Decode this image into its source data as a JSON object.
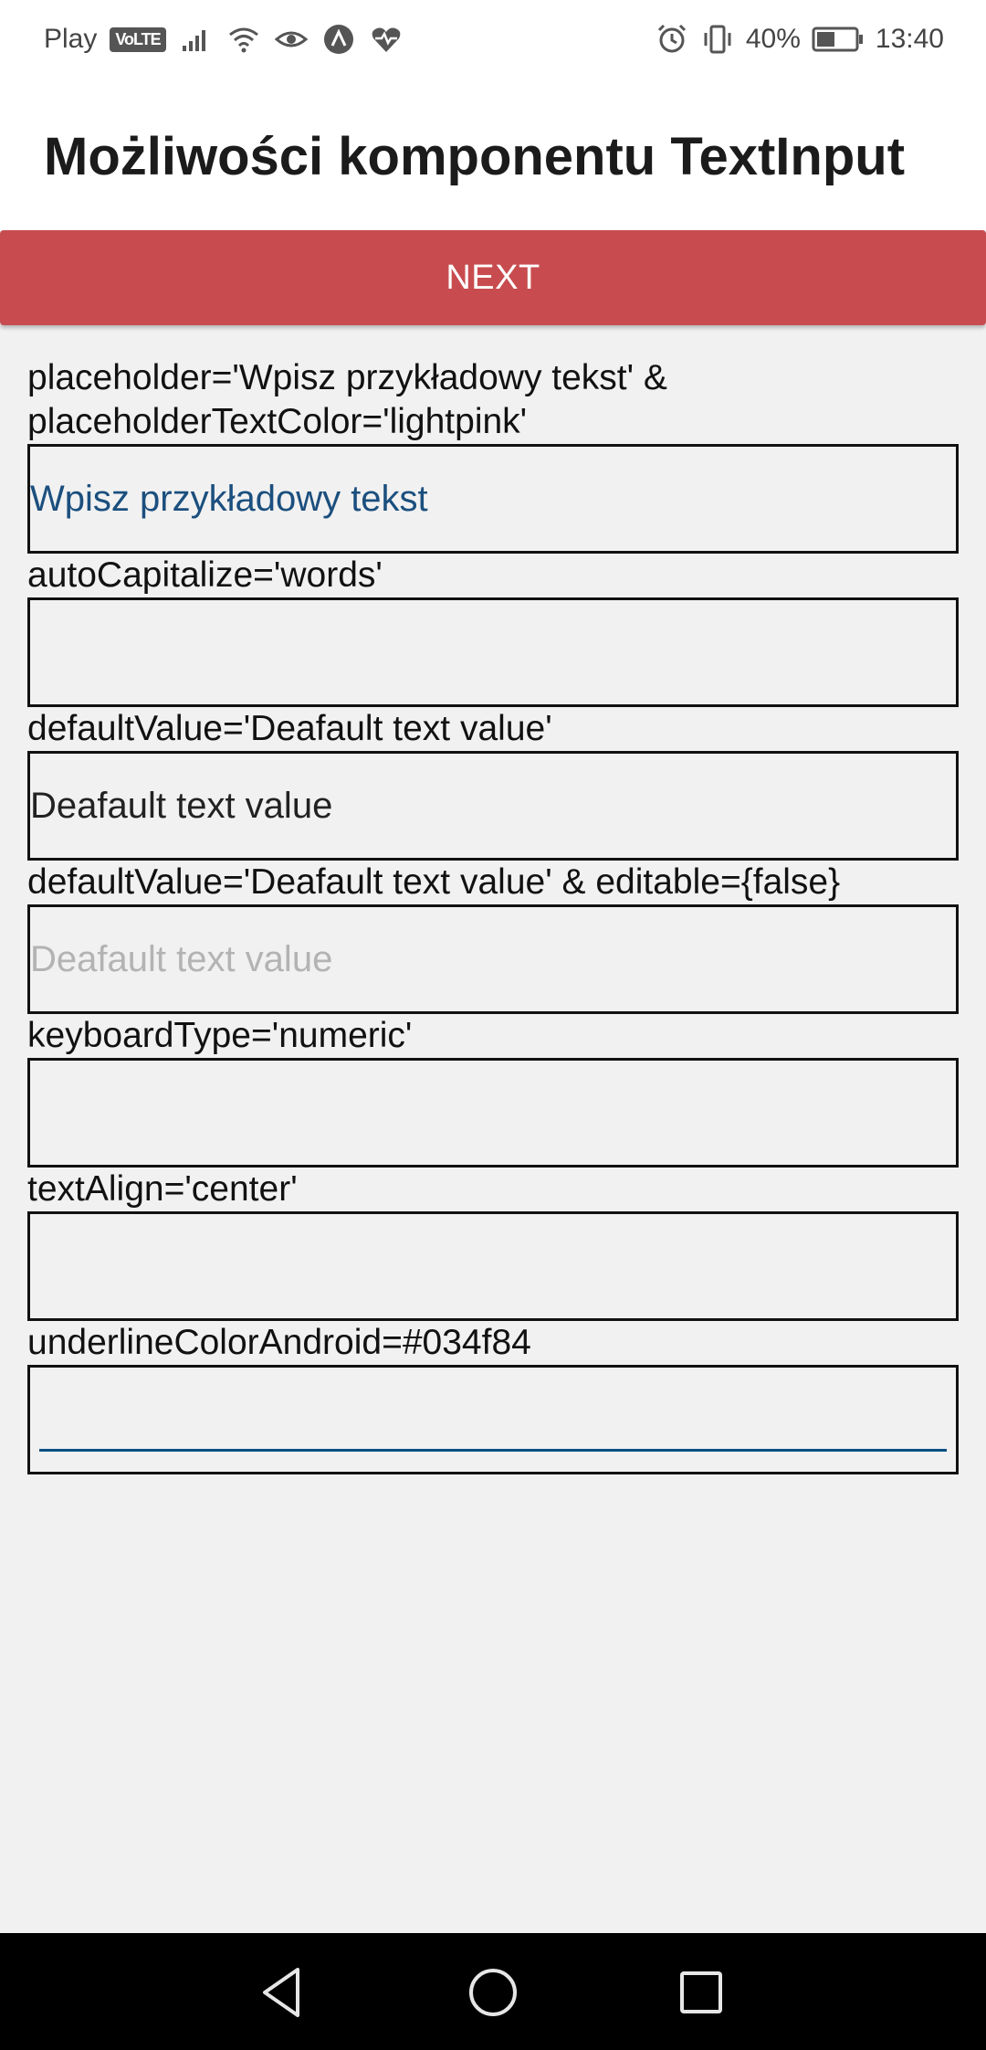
{
  "status_bar": {
    "carrier": "Play",
    "volte": "VoLTE",
    "battery": "40%",
    "time": "13:40"
  },
  "header": {
    "title": "Możliwości komponentu TextInput"
  },
  "toolbar": {
    "next_label": "NEXT"
  },
  "fields": [
    {
      "label": "placeholder='Wpisz przykładowy tekst' &\nplaceholderTextColor='lightpink'",
      "value": "",
      "placeholder": "Wpisz przykładowy tekst"
    },
    {
      "label": "autoCapitalize='words'",
      "value": "",
      "placeholder": ""
    },
    {
      "label": "defaultValue='Deafault text value'",
      "value": "Deafault text value",
      "placeholder": ""
    },
    {
      "label": "defaultValue='Deafault text value' & editable={false}",
      "value": "Deafault text value",
      "placeholder": ""
    },
    {
      "label": "keyboardType='numeric'",
      "value": "",
      "placeholder": ""
    },
    {
      "label": "textAlign='center'",
      "value": "",
      "placeholder": ""
    },
    {
      "label": "underlineColorAndroid=#034f84",
      "value": "",
      "placeholder": ""
    }
  ],
  "colors": {
    "next_button": "#c84c4f",
    "placeholder_text": "#1b4f7e",
    "underline": "#034f84",
    "background": "#f1f1f1"
  },
  "icons": {
    "status": [
      "signal-icon",
      "wifi-icon",
      "eye-icon",
      "app-icon",
      "heart-rate-icon",
      "alarm-icon",
      "vibrate-icon",
      "battery-icon"
    ],
    "nav": [
      "back-icon",
      "home-icon",
      "recents-icon"
    ]
  }
}
